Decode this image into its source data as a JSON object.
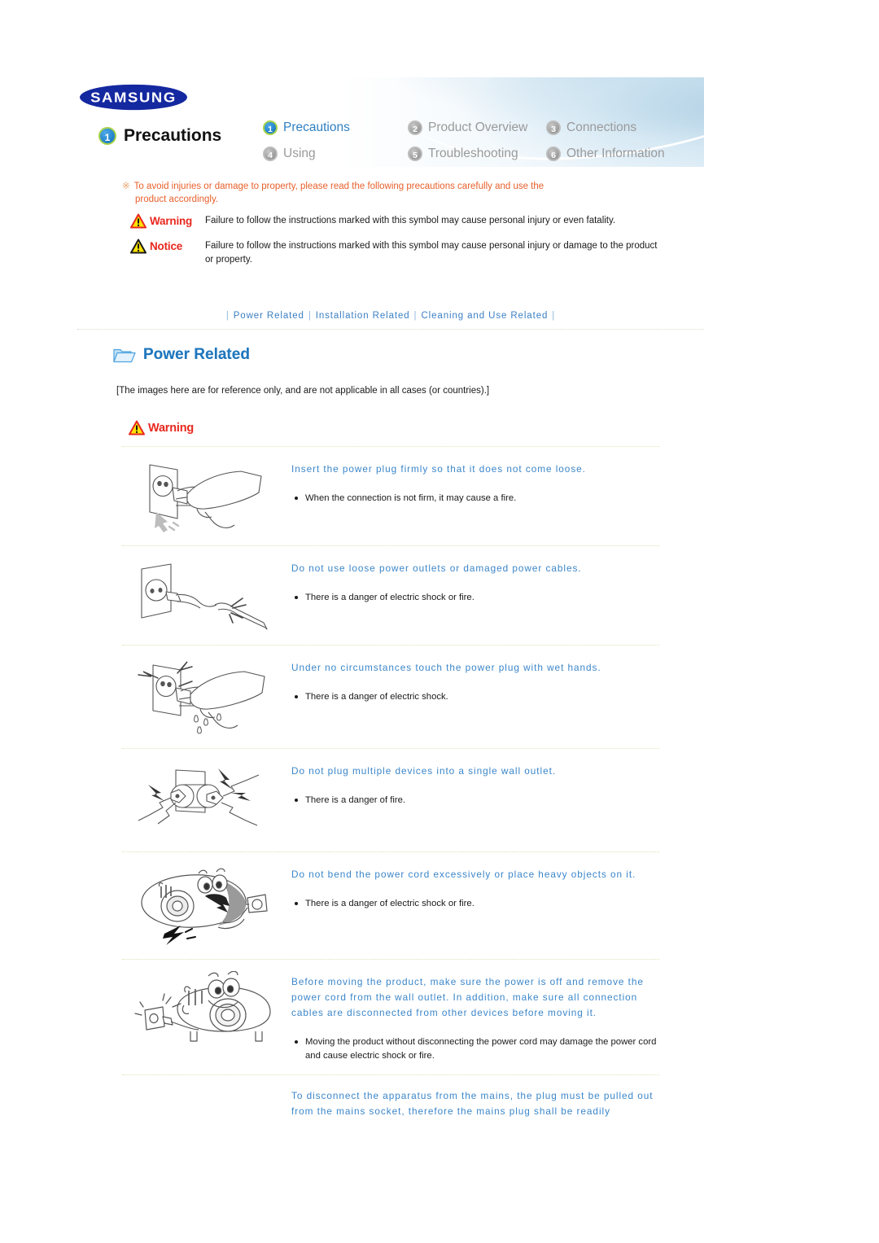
{
  "header": {
    "logo_text": "SAMSUNG",
    "page_title": "Precautions",
    "page_number": "1",
    "nav": [
      {
        "num": "1",
        "label": "Precautions",
        "active": true
      },
      {
        "num": "2",
        "label": "Product Overview",
        "active": false
      },
      {
        "num": "3",
        "label": "Connections",
        "active": false
      },
      {
        "num": "4",
        "label": "Using",
        "active": false
      },
      {
        "num": "5",
        "label": "Troubleshooting",
        "active": false
      },
      {
        "num": "6",
        "label": "Other Information",
        "active": false
      }
    ]
  },
  "intro": {
    "mark": "※",
    "line1": "To avoid injuries or damage to property, please read the following precautions carefully and use the",
    "line2": "product accordingly."
  },
  "legend": {
    "warning_label": "Warning",
    "warning_text": "Failure to follow the instructions marked with this symbol may cause personal injury or even fatality.",
    "notice_label": "Notice",
    "notice_text": "Failure to follow the instructions marked with this symbol may cause personal injury or damage to the product or property."
  },
  "subnav": {
    "bar": "|",
    "items": [
      {
        "label": "Power Related"
      },
      {
        "label": "Installation Related"
      },
      {
        "label": "Cleaning and Use Related"
      }
    ]
  },
  "section": {
    "heading": "Power Related",
    "reference_note": "[The images here are for reference only, and are not applicable in all cases (or countries).]",
    "warning_label": "Warning"
  },
  "items": [
    {
      "figure": "plug-insert-hand",
      "title": "Insert the power plug firmly so that it does not come loose.",
      "bullets": [
        "When the connection is not firm, it may cause a fire."
      ]
    },
    {
      "figure": "damaged-cable-outlet",
      "title": "Do not use loose power outlets or damaged power cables.",
      "bullets": [
        "There is a danger of electric shock or fire."
      ]
    },
    {
      "figure": "wet-hand-plug",
      "title": "Under no circumstances touch the power plug with wet hands.",
      "bullets": [
        "There is a danger of electric shock."
      ]
    },
    {
      "figure": "multiple-plugs-outlet",
      "title": "Do not plug multiple devices into a single wall outlet.",
      "bullets": [
        "There is a danger of fire."
      ]
    },
    {
      "figure": "projector-bent-cord",
      "title": "Do not bend the power cord excessively or place heavy objects on it.",
      "bullets": [
        "There is a danger of electric shock or fire."
      ]
    },
    {
      "figure": "projector-unplug-move",
      "title": "Before moving the product, make sure the power is off and remove the power cord from the wall outlet. In addition, make sure all connection cables are disconnected from other devices before moving it.",
      "bullets": [
        "Moving the product without disconnecting the power cord may damage the power cord and cause electric shock or fire."
      ]
    },
    {
      "figure": "none",
      "title": "To disconnect the apparatus from the mains, the plug must be pulled out from the mains socket, therefore the mains plug shall be readily",
      "bullets": []
    }
  ],
  "colors": {
    "accent_blue": "#3b86c9",
    "heading_blue": "#2077bd",
    "warning_red": "#e8281e",
    "intro_orange": "#e8602c",
    "samsung_blue": "#1428a0",
    "rule_green": "#dbe5b6"
  }
}
